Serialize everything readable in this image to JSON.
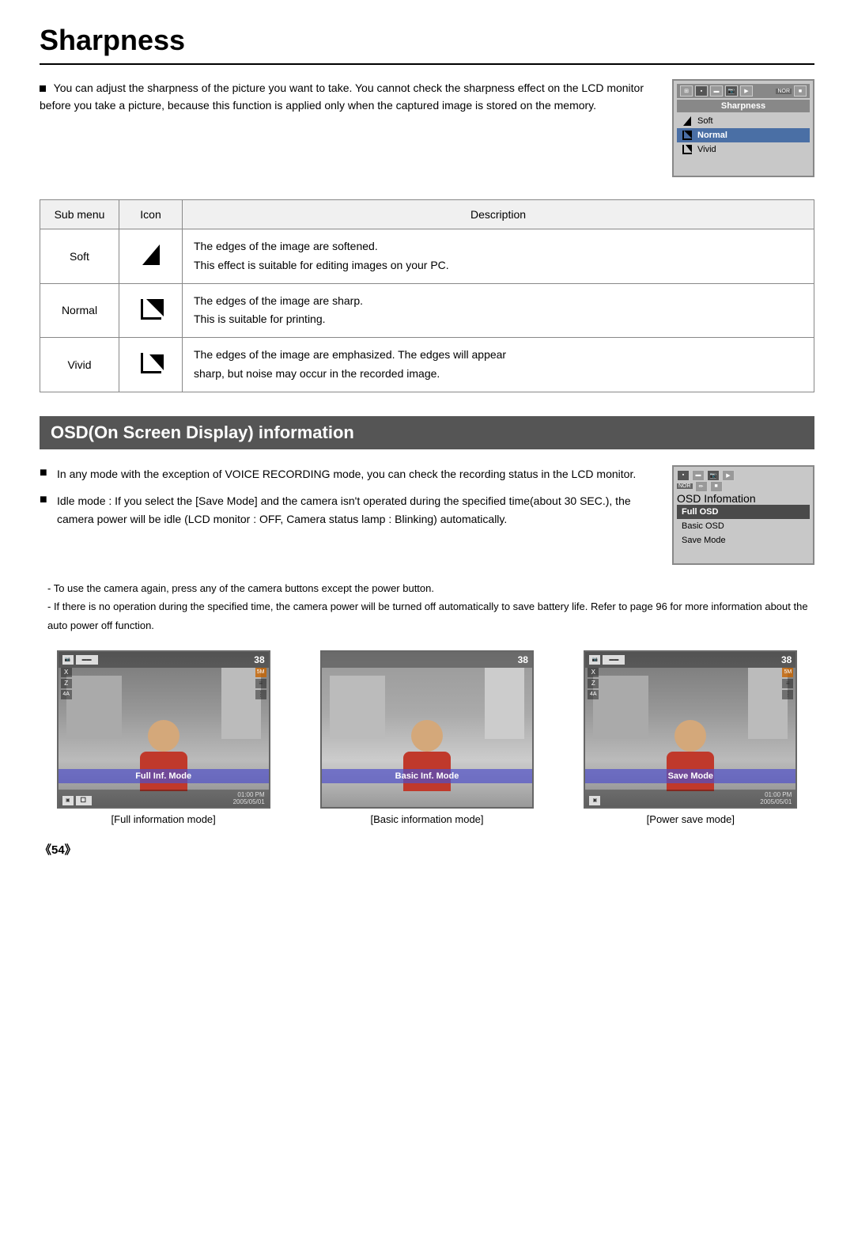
{
  "page": {
    "title": "Sharpness",
    "page_number": "《54》"
  },
  "intro": {
    "bullet": "You can adjust the sharpness of the picture you want to take. You cannot check the sharpness effect on the LCD monitor before you take a picture, because this function is applied only when the captured image is stored on the memory."
  },
  "lcd_sharpness": {
    "title": "Sharpness",
    "items": [
      {
        "label": "Soft",
        "selected": false
      },
      {
        "label": "Normal",
        "selected": true
      },
      {
        "label": "Vivid",
        "selected": false
      }
    ]
  },
  "table": {
    "headers": [
      "Sub menu",
      "Icon",
      "Description"
    ],
    "rows": [
      {
        "sub_menu": "Soft",
        "icon_type": "soft",
        "desc_line1": "The edges of the image are softened.",
        "desc_line2": "This effect is suitable for editing images on your PC."
      },
      {
        "sub_menu": "Normal",
        "icon_type": "normal",
        "desc_line1": "The edges of the image are sharp.",
        "desc_line2": "This is suitable for printing."
      },
      {
        "sub_menu": "Vivid",
        "icon_type": "vivid",
        "desc_line1": "The edges of the image are emphasized. The edges will appear",
        "desc_line2": "sharp, but noise may occur in the recorded image."
      }
    ]
  },
  "osd_section": {
    "heading": "OSD(On Screen Display) information",
    "bullets": [
      "In any mode with the exception of VOICE RECORDING mode, you can check the recording status in the LCD monitor.",
      "Idle mode : If you select the [Save Mode] and the camera isn't operated during the specified time(about 30 SEC.), the camera power will be idle (LCD monitor : OFF, Camera status lamp : Blinking) automatically."
    ],
    "notes": [
      "- To use the camera again, press any of the camera buttons except the power button.",
      "- If there is no operation during the specified time, the camera power will be turned off automatically to save battery life. Refer to page 96 for more information about the auto power off function."
    ]
  },
  "osd_lcd": {
    "title": "OSD Infomation",
    "items": [
      {
        "label": "Full OSD",
        "selected": true
      },
      {
        "label": "Basic OSD",
        "selected": false
      },
      {
        "label": "Save Mode",
        "selected": false
      }
    ]
  },
  "screenshots": [
    {
      "label_bar": "Full Inf. Mode",
      "caption": "[Full information mode]",
      "hud_num": "38",
      "time": "01:00 PM",
      "date": "2005/05/01",
      "show_left": true,
      "show_right": true
    },
    {
      "label_bar": "Basic Inf. Mode",
      "caption": "[Basic information mode]",
      "hud_num": "38",
      "time": "",
      "date": "",
      "show_left": false,
      "show_right": false
    },
    {
      "label_bar": "Save Mode",
      "caption": "[Power save mode]",
      "hud_num": "38",
      "time": "01:00 PM",
      "date": "2005/05/01",
      "show_left": true,
      "show_right": true
    }
  ]
}
